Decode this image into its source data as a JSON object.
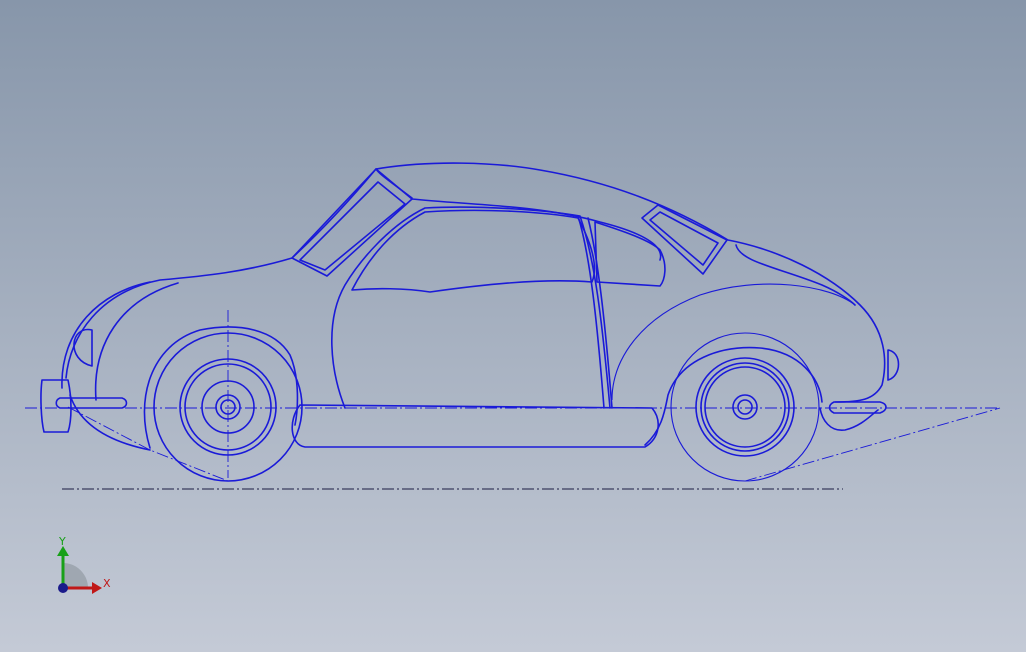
{
  "view": {
    "background_top": "#8796aa",
    "background_bottom": "#c4cad6",
    "edge_color": "#1a1ad8"
  },
  "triad": {
    "x_label": "X",
    "y_label": "Y",
    "x_color": "#c01818",
    "y_color": "#18a018",
    "origin_color": "#1a1a8a"
  }
}
